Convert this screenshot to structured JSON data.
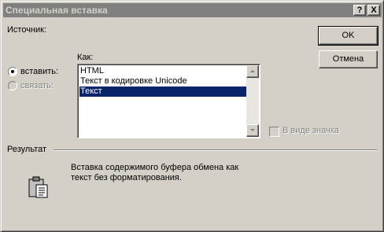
{
  "window": {
    "title": "Специальная вставка",
    "help_button": "?",
    "close_button": "X"
  },
  "source": {
    "label": "Источник:"
  },
  "buttons": {
    "ok": "OK",
    "cancel": "Отмена"
  },
  "options": {
    "paste_label": "вставить:",
    "paste_selected": true,
    "link_label": "связать:",
    "link_enabled": false
  },
  "as": {
    "label": "Как:",
    "items": [
      "HTML",
      "Текст в кодировке Unicode",
      "Текст"
    ],
    "selected_index": 2
  },
  "display_as_icon": {
    "label": "В виде значка",
    "checked": false,
    "enabled": false
  },
  "result": {
    "label": "Результат",
    "line1": "Вставка содержимого буфера обмена как",
    "line2": "текст без форматирования.",
    "icon": "clipboard-icon"
  },
  "colors": {
    "title_bar": "#808080",
    "selection": "#0a246a",
    "face": "#d4d0c8"
  }
}
